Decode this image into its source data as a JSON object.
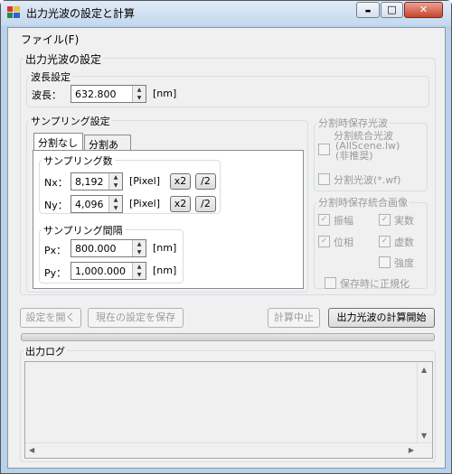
{
  "window": {
    "title": "出力光波の設定と計算",
    "controls": {
      "minimize": "▬",
      "maximize": "□",
      "close": "✕"
    }
  },
  "menu": {
    "file": "ファイル(F)"
  },
  "output_settings": {
    "group_title": "出力光波の設定",
    "wavelength": {
      "group_title": "波長設定",
      "label": "波長：",
      "value": "632.800",
      "unit": "[nm]"
    },
    "sampling": {
      "group_title": "サンプリング設定",
      "tabs": [
        {
          "label": "分割なし",
          "selected": true
        },
        {
          "label": "分割あり",
          "selected": false
        }
      ],
      "count": {
        "group_title": "サンプリング数",
        "nx": {
          "label": "Nx：",
          "value": "8,192",
          "unit": "[Pixel]",
          "mul": "x2",
          "div": "/2"
        },
        "ny": {
          "label": "Ny：",
          "value": "4,096",
          "unit": "[Pixel]",
          "mul": "x2",
          "div": "/2"
        }
      },
      "interval": {
        "group_title": "サンプリング間隔",
        "px": {
          "label": "Px：",
          "value": "800.000",
          "unit": "[nm]"
        },
        "py": {
          "label": "Py：",
          "value": "1,000.000",
          "unit": "[nm]"
        }
      }
    },
    "split_save": {
      "group_title": "分割時保存光波",
      "merged_line1": "分割統合光波",
      "merged_line2": "(AllScene.lw)",
      "merged_line3": "(非推奨)",
      "split_waves": "分割光波(*.wf)"
    },
    "split_image": {
      "group_title": "分割時保存統合画像",
      "amplitude": "振幅",
      "real": "実数",
      "phase": "位相",
      "imag": "虚数",
      "intensity": "強度",
      "normalize": "保存時に正規化"
    }
  },
  "buttons": {
    "open_settings": "設定を開く",
    "save_settings": "現在の設定を保存",
    "stop": "計算中止",
    "start": "出力光波の計算開始"
  },
  "log": {
    "group_title": "出力ログ"
  }
}
